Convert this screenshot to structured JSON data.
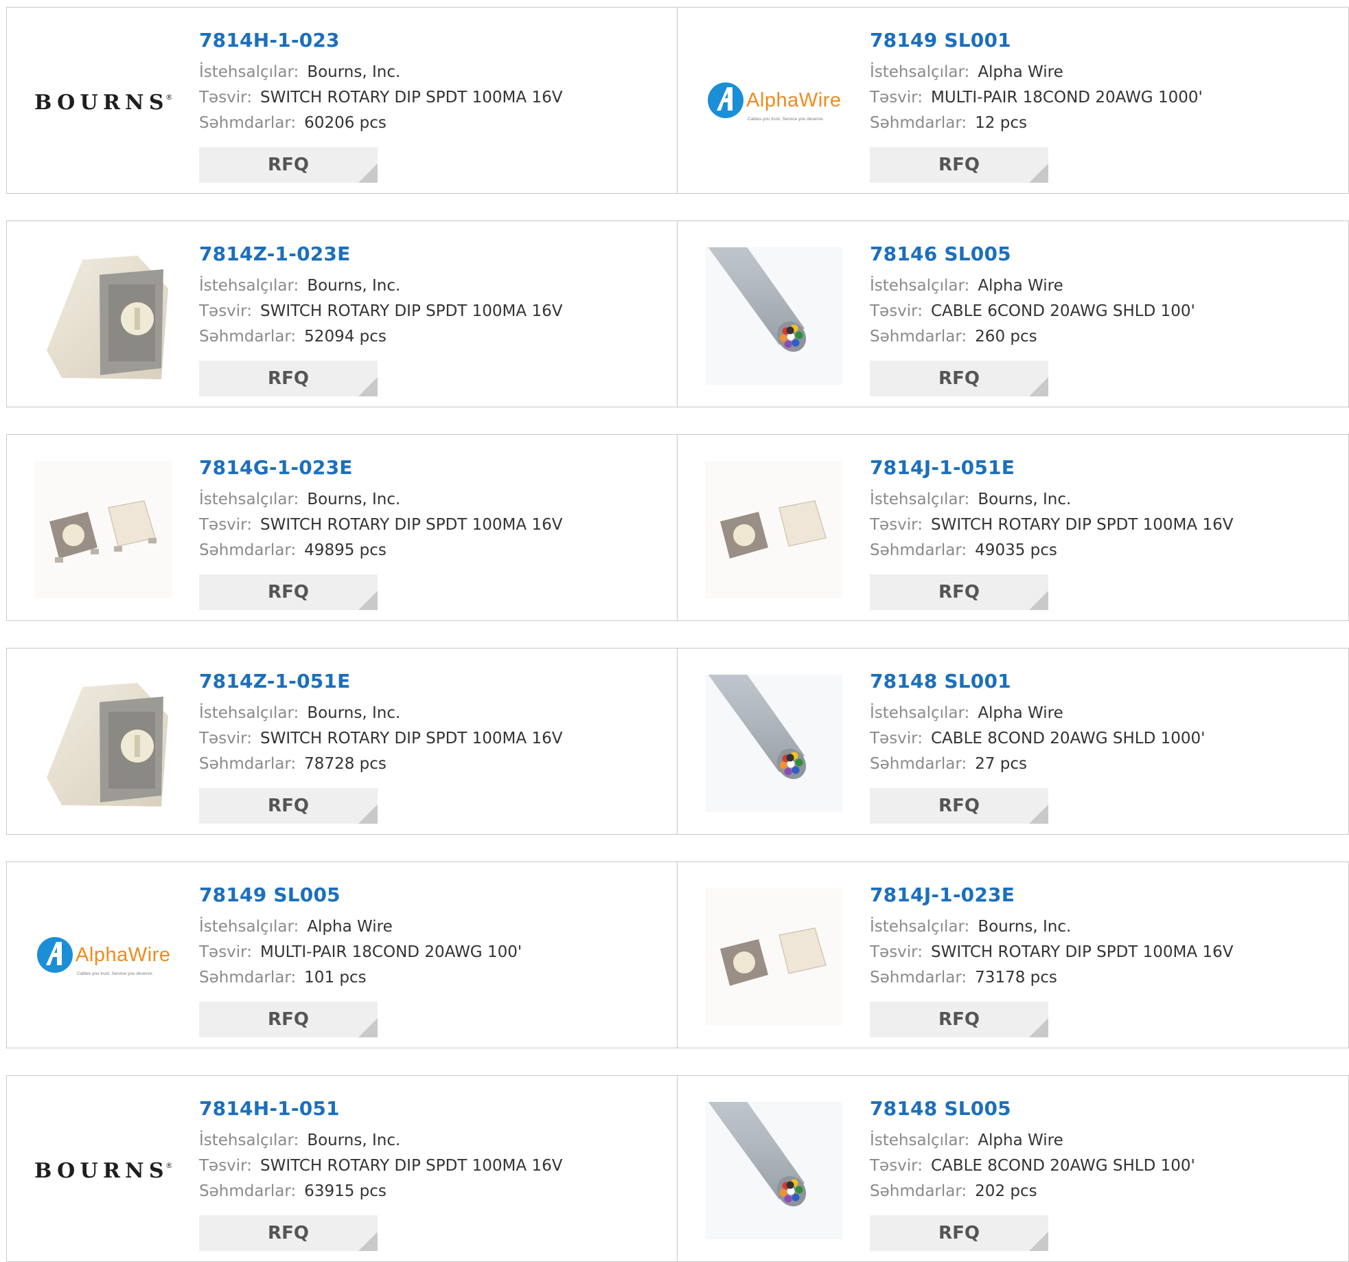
{
  "labels": {
    "manufacturer": "İstehsalçılar:",
    "description": "Təsvir:",
    "stock": "Səhmdarlar:",
    "rfq": "RFQ"
  },
  "logos": {
    "bourns": "BOURNS",
    "bourns_mark": "®",
    "alphawire": "AlphaWire",
    "alphawire_tagline": "Cables you trust. Service you deserve."
  },
  "products": [
    {
      "part": "7814H-1-023",
      "manufacturer": "Bourns, Inc.",
      "description": "SWITCH ROTARY DIP SPDT 100MA 16V",
      "stock": "60206 pcs",
      "image": "bourns-logo"
    },
    {
      "part": "78149 SL001",
      "manufacturer": "Alpha Wire",
      "description": "MULTI-PAIR 18COND 20AWG 1000'",
      "stock": "12 pcs",
      "image": "alphawire-logo"
    },
    {
      "part": "7814Z-1-023E",
      "manufacturer": "Bourns, Inc.",
      "description": "SWITCH ROTARY DIP SPDT 100MA 16V",
      "stock": "52094 pcs",
      "image": "rotary-switch-angled"
    },
    {
      "part": "78146 SL005",
      "manufacturer": "Alpha Wire",
      "description": "CABLE 6COND 20AWG SHLD 100'",
      "stock": "260 pcs",
      "image": "grey-cable"
    },
    {
      "part": "7814G-1-023E",
      "manufacturer": "Bourns, Inc.",
      "description": "SWITCH ROTARY DIP SPDT 100MA 16V",
      "stock": "49895 pcs",
      "image": "rotary-switch-pair-smd"
    },
    {
      "part": "7814J-1-051E",
      "manufacturer": "Bourns, Inc.",
      "description": "SWITCH ROTARY DIP SPDT 100MA 16V",
      "stock": "49035 pcs",
      "image": "rotary-switch-pair"
    },
    {
      "part": "7814Z-1-051E",
      "manufacturer": "Bourns, Inc.",
      "description": "SWITCH ROTARY DIP SPDT 100MA 16V",
      "stock": "78728 pcs",
      "image": "rotary-switch-angled"
    },
    {
      "part": "78148 SL001",
      "manufacturer": "Alpha Wire",
      "description": "CABLE 8COND 20AWG SHLD 1000'",
      "stock": "27 pcs",
      "image": "grey-cable"
    },
    {
      "part": "78149 SL005",
      "manufacturer": "Alpha Wire",
      "description": "MULTI-PAIR 18COND 20AWG 100'",
      "stock": "101 pcs",
      "image": "alphawire-logo"
    },
    {
      "part": "7814J-1-023E",
      "manufacturer": "Bourns, Inc.",
      "description": "SWITCH ROTARY DIP SPDT 100MA 16V",
      "stock": "73178 pcs",
      "image": "rotary-switch-pair"
    },
    {
      "part": "7814H-1-051",
      "manufacturer": "Bourns, Inc.",
      "description": "SWITCH ROTARY DIP SPDT 100MA 16V",
      "stock": "63915 pcs",
      "image": "bourns-logo"
    },
    {
      "part": "78148 SL005",
      "manufacturer": "Alpha Wire",
      "description": "CABLE 8COND 20AWG SHLD 100'",
      "stock": "202 pcs",
      "image": "grey-cable"
    }
  ],
  "colors": {
    "part_link": "#1b6fbd",
    "label_grey": "#8a8a8a",
    "value_text": "#333333",
    "rfq_bg": "#efefef",
    "rfq_corner": "#c9c9c9",
    "card_border": "#c9c9c9",
    "alphawire_blue": "#1a8fd8",
    "alphawire_orange": "#f08a1c"
  }
}
